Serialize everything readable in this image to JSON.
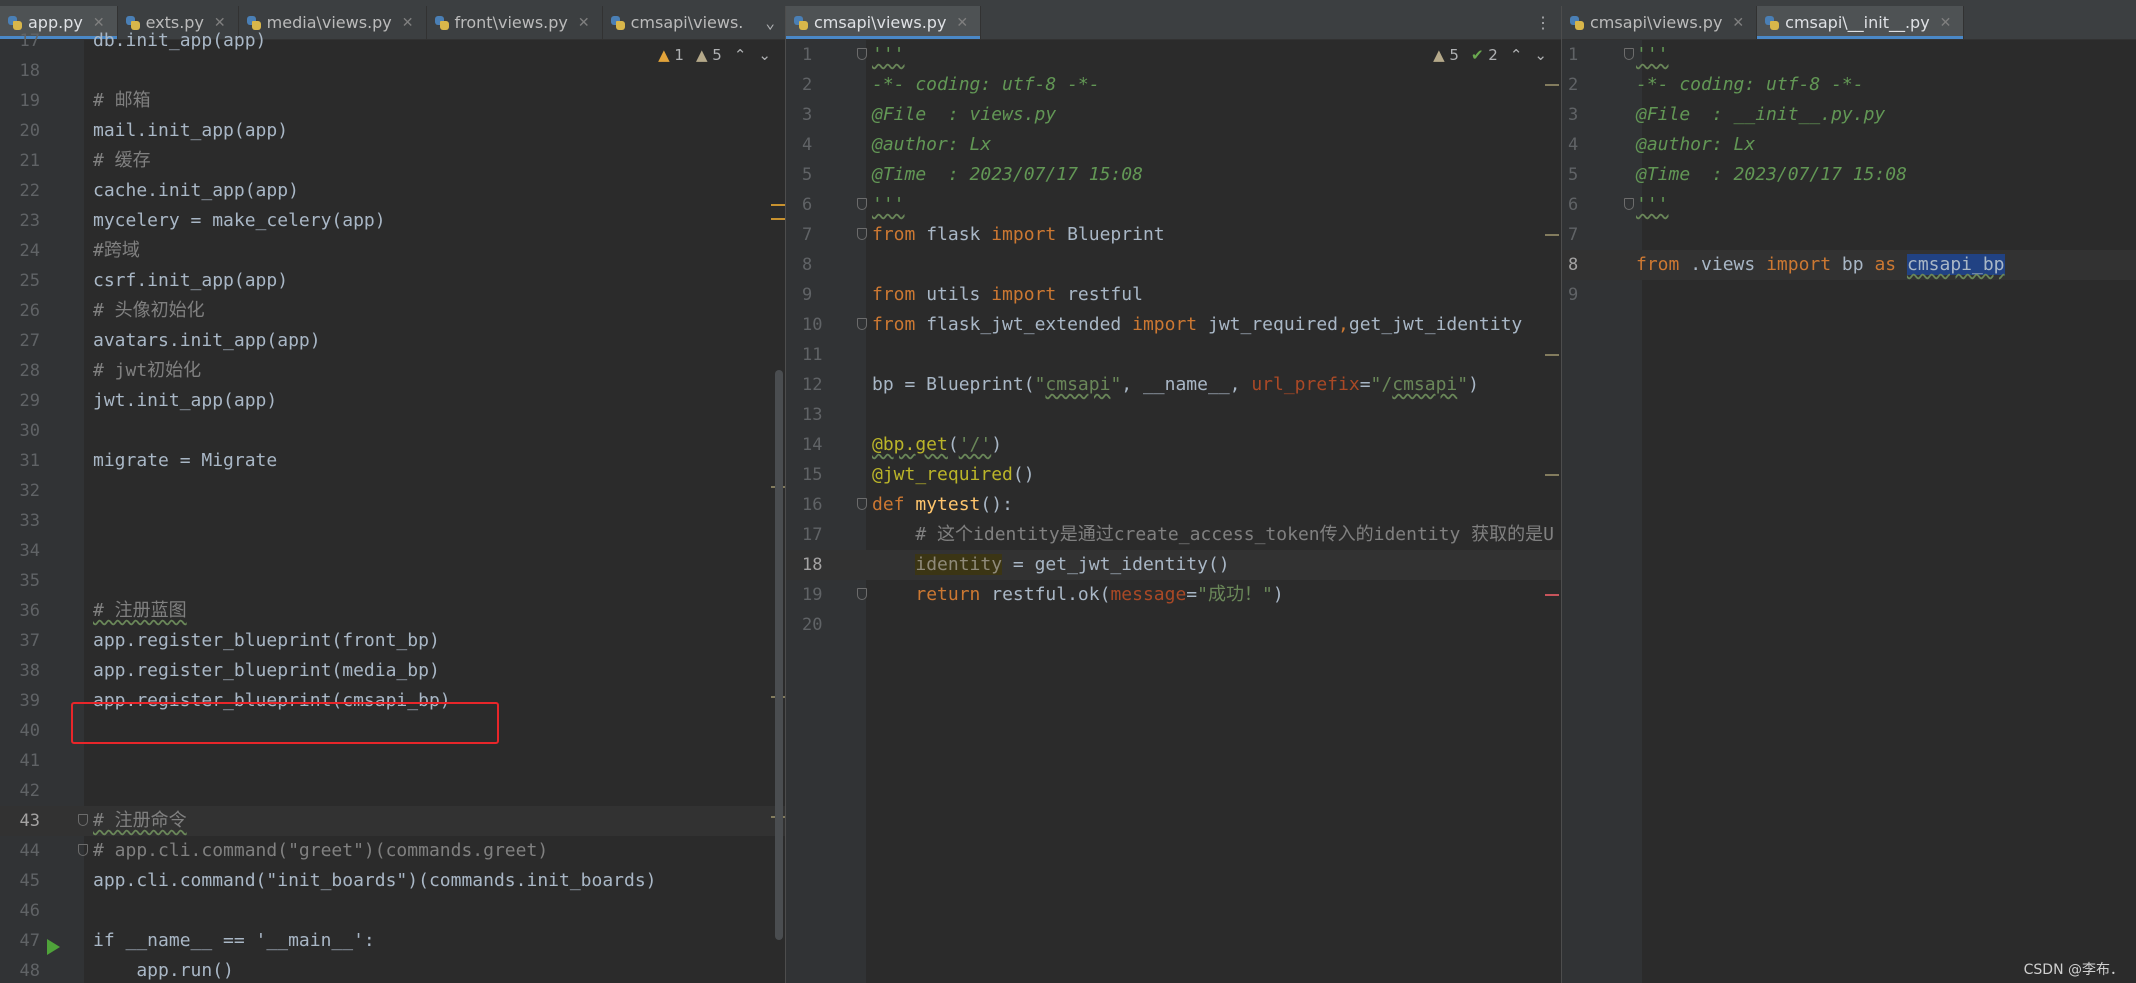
{
  "left_pane": {
    "tabs": [
      {
        "label": "app.py",
        "active": true
      },
      {
        "label": "exts.py",
        "active": false
      },
      {
        "label": "media\\views.py",
        "active": false
      },
      {
        "label": "front\\views.py",
        "active": false
      },
      {
        "label": "cmsapi\\views.",
        "active": false
      }
    ],
    "inspection": {
      "warnings": "1",
      "weak_warnings": "5"
    },
    "lines": [
      {
        "n": "17",
        "code": "db.init_app(app)"
      },
      {
        "n": "18",
        "code": ""
      },
      {
        "n": "19",
        "code": "# 邮箱"
      },
      {
        "n": "20",
        "code": "mail.init_app(app)"
      },
      {
        "n": "21",
        "code": "# 缓存"
      },
      {
        "n": "22",
        "code": "cache.init_app(app)"
      },
      {
        "n": "23",
        "code": "mycelery = make_celery(app)"
      },
      {
        "n": "24",
        "code": "#跨域"
      },
      {
        "n": "25",
        "code": "csrf.init_app(app)"
      },
      {
        "n": "26",
        "code": "# 头像初始化"
      },
      {
        "n": "27",
        "code": "avatars.init_app(app)"
      },
      {
        "n": "28",
        "code": "# jwt初始化"
      },
      {
        "n": "29",
        "code": "jwt.init_app(app)"
      },
      {
        "n": "30",
        "code": ""
      },
      {
        "n": "31",
        "code": "migrate = Migrate"
      },
      {
        "n": "32",
        "code": ""
      },
      {
        "n": "33",
        "code": ""
      },
      {
        "n": "34",
        "code": ""
      },
      {
        "n": "35",
        "code": ""
      },
      {
        "n": "36",
        "code": "# 注册蓝图"
      },
      {
        "n": "37",
        "code": "app.register_blueprint(front_bp)"
      },
      {
        "n": "38",
        "code": "app.register_blueprint(media_bp)"
      },
      {
        "n": "39",
        "code": "app.register_blueprint(cmsapi_bp)"
      },
      {
        "n": "40",
        "code": ""
      },
      {
        "n": "41",
        "code": ""
      },
      {
        "n": "42",
        "code": ""
      },
      {
        "n": "43",
        "code": "# 注册命令"
      },
      {
        "n": "44",
        "code": "# app.cli.command(\"greet\")(commands.greet)"
      },
      {
        "n": "45",
        "code": "app.cli.command(\"init_boards\")(commands.init_boards)"
      },
      {
        "n": "46",
        "code": ""
      },
      {
        "n": "47",
        "code": "if __name__ == '__main__':"
      },
      {
        "n": "48",
        "code": "    app.run()"
      }
    ]
  },
  "mid_pane": {
    "tabs": [
      {
        "label": "cmsapi\\views.py",
        "active": true
      }
    ],
    "inspection": {
      "warnings": "5",
      "ok": "2"
    },
    "lines": [
      {
        "n": "1",
        "code": "'''"
      },
      {
        "n": "2",
        "code": "-*- coding: utf-8 -*-"
      },
      {
        "n": "3",
        "code": "@File  : views.py"
      },
      {
        "n": "4",
        "code": "@author: Lx"
      },
      {
        "n": "5",
        "code": "@Time  : 2023/07/17 15:08"
      },
      {
        "n": "6",
        "code": "'''"
      },
      {
        "n": "7",
        "code": "from flask import Blueprint"
      },
      {
        "n": "8",
        "code": ""
      },
      {
        "n": "9",
        "code": "from utils import restful"
      },
      {
        "n": "10",
        "code": "from flask_jwt_extended import jwt_required,get_jwt_identity"
      },
      {
        "n": "11",
        "code": ""
      },
      {
        "n": "12",
        "code": "bp = Blueprint(\"cmsapi\", __name__, url_prefix=\"/cmsapi\")"
      },
      {
        "n": "13",
        "code": ""
      },
      {
        "n": "14",
        "code": "@bp.get('/')"
      },
      {
        "n": "15",
        "code": "@jwt_required()"
      },
      {
        "n": "16",
        "code": "def mytest():"
      },
      {
        "n": "17",
        "code": "    # 这个identity是通过create_access_token传入的identity 获取的是U"
      },
      {
        "n": "18",
        "code": "    identity = get_jwt_identity()"
      },
      {
        "n": "19",
        "code": "    return restful.ok(message=\"成功！\")"
      },
      {
        "n": "20",
        "code": ""
      }
    ]
  },
  "right_pane": {
    "tabs": [
      {
        "label": "cmsapi\\views.py",
        "active": false
      },
      {
        "label": "cmsapi\\__init__.py",
        "active": true
      }
    ],
    "lines": [
      {
        "n": "1",
        "code": "'''"
      },
      {
        "n": "2",
        "code": "-*- coding: utf-8 -*-"
      },
      {
        "n": "3",
        "code": "@File  : __init__.py.py"
      },
      {
        "n": "4",
        "code": "@author: Lx"
      },
      {
        "n": "5",
        "code": "@Time  : 2023/07/17 15:08"
      },
      {
        "n": "6",
        "code": "'''"
      },
      {
        "n": "7",
        "code": ""
      },
      {
        "n": "8",
        "code": "from .views import bp as cmsapi_bp"
      },
      {
        "n": "9",
        "code": ""
      }
    ]
  },
  "watermark": "CSDN @李布．",
  "colors": {
    "keyword": "#cc7832",
    "comment": "#808080",
    "docstring": "#629755",
    "string": "#6a8759",
    "decorator": "#bbb529",
    "function": "#ffc66d",
    "highlight_box": "#e8262a"
  }
}
